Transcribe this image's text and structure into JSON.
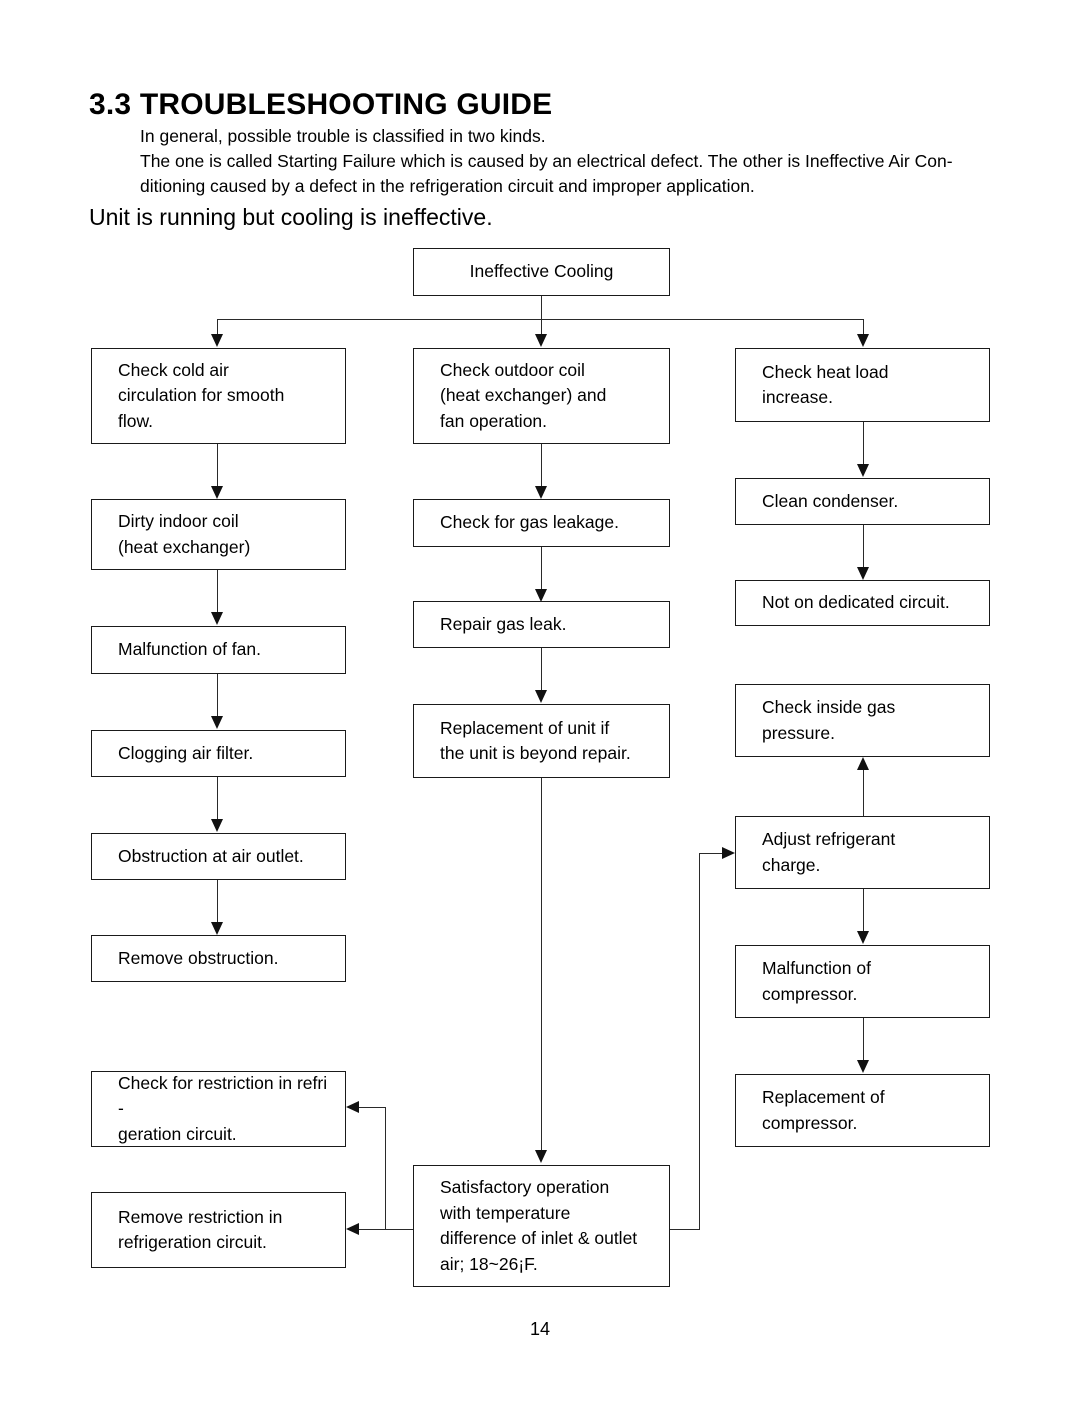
{
  "document": {
    "heading": "3.3 TROUBLESHOOTING GUIDE",
    "intro_lines": [
      "In general, possible trouble is classified in two kinds.",
      "The one is called Starting Failure   which is caused by an electrical defect. The other is Ineffective Air Con-",
      "ditioning   caused by a defect in the refrigeration circuit and improper application."
    ],
    "subheading": "Unit is running but cooling is ineffective.",
    "page_number": "14"
  },
  "flowchart": {
    "type": "flowchart",
    "root": {
      "id": "ineffective-cooling",
      "label": "Ineffective Cooling"
    },
    "columns": [
      {
        "id": "left-branch",
        "nodes": [
          {
            "id": "check-cold-air-circulation",
            "label": "Check cold air\ncirculation for smooth\nflow."
          },
          {
            "id": "dirty-indoor-coil",
            "label": "Dirty indoor coil\n(heat exchanger)"
          },
          {
            "id": "malfunction-of-fan",
            "label": "Malfunction of fan."
          },
          {
            "id": "clogging-air-filter",
            "label": "Clogging air filter."
          },
          {
            "id": "obstruction-at-air-outlet",
            "label": "Obstruction at air outlet."
          },
          {
            "id": "remove-obstruction",
            "label": "Remove obstruction."
          },
          {
            "id": "check-for-restriction",
            "label": "Check for restriction in refri -\ngeration circuit."
          },
          {
            "id": "remove-restriction",
            "label": "Remove restriction  in\nrefrigeration circuit."
          }
        ]
      },
      {
        "id": "middle-branch",
        "nodes": [
          {
            "id": "check-outdoor-coil",
            "label": "Check outdoor coil\n(heat exchanger) and\nfan operation."
          },
          {
            "id": "check-for-gas-leakage",
            "label": "Check for gas leakage."
          },
          {
            "id": "repair-gas-leak",
            "label": "Repair gas leak."
          },
          {
            "id": "replacement-of-unit",
            "label": "Replacement of unit if\nthe unit is beyond repair."
          },
          {
            "id": "satisfactory-operation",
            "label": "Satisfactory operation\nwith temperature\ndifference of inlet & outlet\nair; 18~26¡F."
          }
        ]
      },
      {
        "id": "right-branch",
        "nodes": [
          {
            "id": "check-heat-load-increase",
            "label": "Check heat load\nincrease."
          },
          {
            "id": "clean-condenser",
            "label": "Clean condenser."
          },
          {
            "id": "not-on-dedicated-circuit",
            "label": "Not on dedicated circuit."
          },
          {
            "id": "check-inside-gas-pressure",
            "label": "Check inside gas\npressure."
          },
          {
            "id": "adjust-refrigerant-charge",
            "label": "Adjust refrigerant\ncharge."
          },
          {
            "id": "malfunction-of-compressor",
            "label": "Malfunction of\ncompressor."
          },
          {
            "id": "replacement-of-compressor",
            "label": "Replacement of\ncompressor."
          }
        ]
      }
    ],
    "edges": [
      {
        "from": "ineffective-cooling",
        "to": "check-cold-air-circulation",
        "style": "elbow-down"
      },
      {
        "from": "ineffective-cooling",
        "to": "check-outdoor-coil",
        "style": "straight-down"
      },
      {
        "from": "ineffective-cooling",
        "to": "check-heat-load-increase",
        "style": "elbow-down"
      },
      {
        "from": "check-cold-air-circulation",
        "to": "dirty-indoor-coil",
        "style": "straight-down"
      },
      {
        "from": "dirty-indoor-coil",
        "to": "malfunction-of-fan",
        "style": "straight-down"
      },
      {
        "from": "malfunction-of-fan",
        "to": "clogging-air-filter",
        "style": "straight-down"
      },
      {
        "from": "clogging-air-filter",
        "to": "obstruction-at-air-outlet",
        "style": "straight-down"
      },
      {
        "from": "obstruction-at-air-outlet",
        "to": "remove-obstruction",
        "style": "straight-down"
      },
      {
        "from": "check-outdoor-coil",
        "to": "check-for-gas-leakage",
        "style": "straight-down"
      },
      {
        "from": "check-for-gas-leakage",
        "to": "repair-gas-leak",
        "style": "straight-down"
      },
      {
        "from": "repair-gas-leak",
        "to": "replacement-of-unit",
        "style": "straight-down"
      },
      {
        "from": "replacement-of-unit",
        "to": "satisfactory-operation",
        "style": "straight-down"
      },
      {
        "from": "check-heat-load-increase",
        "to": "clean-condenser",
        "style": "straight-down"
      },
      {
        "from": "clean-condenser",
        "to": "not-on-dedicated-circuit",
        "style": "straight-down"
      },
      {
        "from": "adjust-refrigerant-charge",
        "to": "check-inside-gas-pressure",
        "style": "straight-up"
      },
      {
        "from": "adjust-refrigerant-charge",
        "to": "malfunction-of-compressor",
        "style": "straight-down"
      },
      {
        "from": "malfunction-of-compressor",
        "to": "replacement-of-compressor",
        "style": "straight-down"
      },
      {
        "from": "satisfactory-operation",
        "to": "adjust-refrigerant-charge",
        "style": "elbow-right-up"
      },
      {
        "from": "satisfactory-operation",
        "to": "check-for-restriction",
        "style": "elbow-left-up"
      },
      {
        "from": "satisfactory-operation",
        "to": "remove-restriction",
        "style": "elbow-left"
      }
    ]
  }
}
